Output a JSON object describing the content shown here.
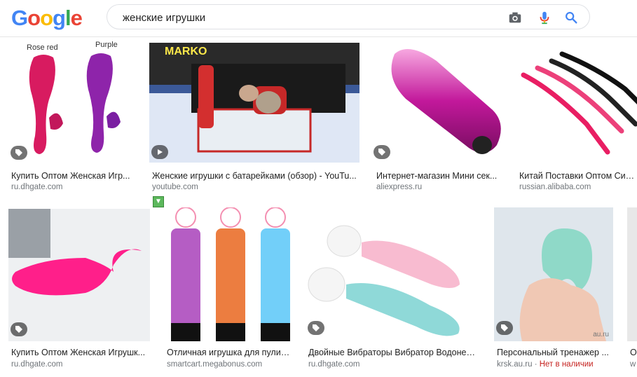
{
  "header": {
    "logo_letters": [
      "G",
      "o",
      "o",
      "g",
      "l",
      "e"
    ],
    "search_value": "женские игрушки",
    "icons": [
      "camera-icon",
      "microphone-icon",
      "search-icon"
    ]
  },
  "results": [
    {
      "caption": "Купить Оптом Женская Игр...",
      "source": "ru.dhgate.com",
      "labels": [
        "Rose red",
        "Purple"
      ]
    },
    {
      "caption": "Женские игрушки с батарейками (обзор) - YouTu...",
      "source": "youtube.com",
      "watermark": "MARKO"
    },
    {
      "caption": "Интернет-магазин Мини сек...",
      "source": "aliexpress.ru"
    },
    {
      "caption": "Китай Поставки Оптом Сили...",
      "source": "russian.alibaba.com"
    },
    {
      "caption": "Купить Оптом Женская Игрушк...",
      "source": "ru.dhgate.com"
    },
    {
      "caption": "Отличная игрушка для пули,...",
      "source": "smartcart.megabonus.com"
    },
    {
      "caption": "Двойные Вибраторы Вибратор Водонеп...",
      "source": "ru.dhgate.com"
    },
    {
      "caption": "Персональный тренажер ...",
      "source": "krsk.au.ru",
      "source_sep": " · ",
      "availability": "Нет в наличии",
      "watermark": "au.ru"
    },
    {
      "caption": "О",
      "source": "w"
    }
  ],
  "colors": {
    "pink": "#e0197d",
    "purple": "#8e24aa",
    "magenta": "#c2185b",
    "mint": "#8fd9c8",
    "unavailable": "#c5221f"
  }
}
